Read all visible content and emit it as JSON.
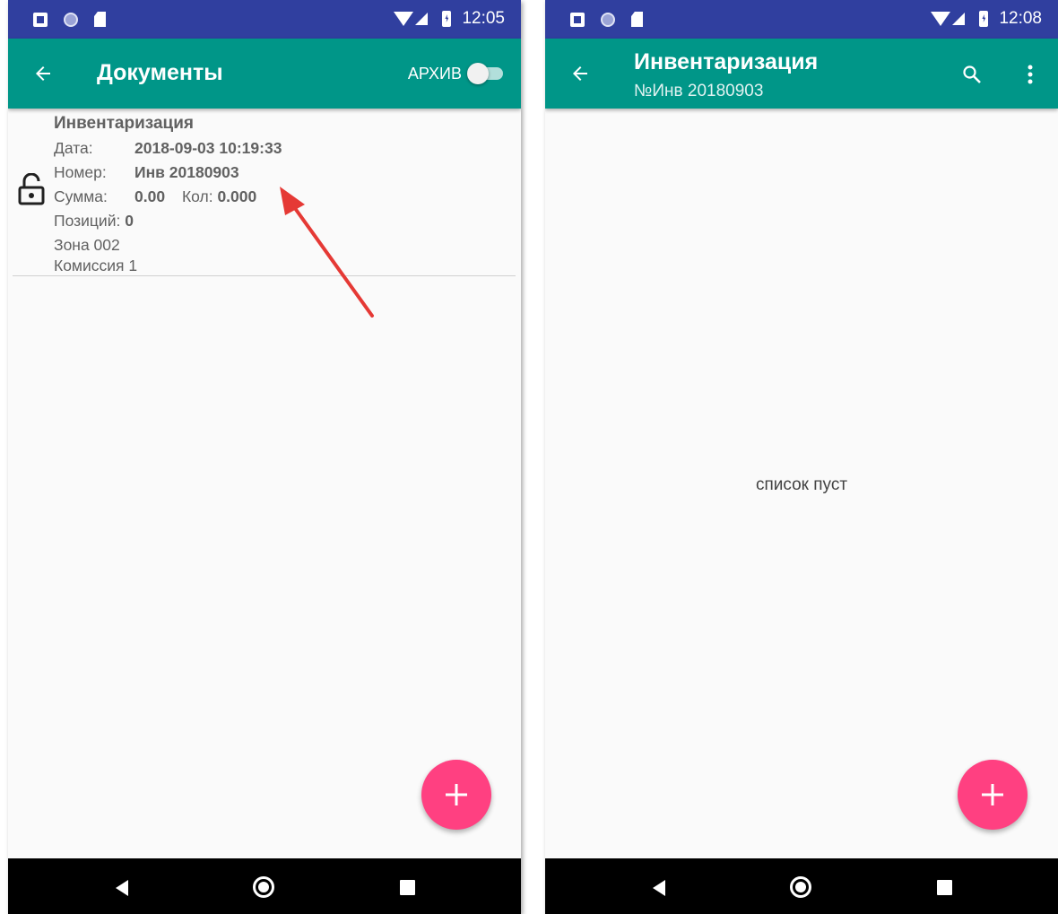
{
  "left_screen": {
    "status_bar": {
      "time": "12:05"
    },
    "app_bar": {
      "title": "Документы",
      "archive_label": "АРХИВ",
      "archive_toggle_on": false
    },
    "document": {
      "title": "Инвентаризация",
      "date_label": "Дата:",
      "date_value": "2018-09-03 10:19:33",
      "number_label": "Номер:",
      "number_value": "Инв 20180903",
      "sum_label": "Сумма:",
      "sum_value": "0.00",
      "qty_label": "Кол:",
      "qty_value": "0.000",
      "positions_label": "Позиций:",
      "positions_value": "0",
      "zone": "Зона 002",
      "commission": "Комиссия 1",
      "lock_icon": "lock-open-icon"
    },
    "fab_icon": "plus-icon"
  },
  "right_screen": {
    "status_bar": {
      "time": "12:08"
    },
    "app_bar": {
      "title": "Инвентаризация",
      "subtitle": "№Инв 20180903"
    },
    "empty_text": "список пуст",
    "fab_icon": "plus-icon"
  },
  "colors": {
    "status_bar": "#303f9f",
    "app_bar": "#009688",
    "fab": "#ff4081",
    "annotation_arrow": "#e53935"
  }
}
